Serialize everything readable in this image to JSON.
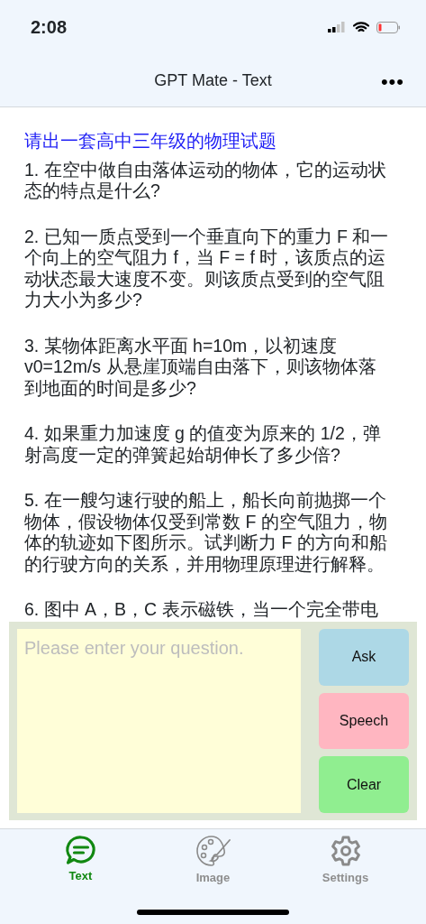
{
  "status_bar": {
    "time": "2:08"
  },
  "nav_bar": {
    "title": "GPT Mate - Text",
    "more": "•••"
  },
  "conversation": {
    "question": "请出一套高中三年级的物理试题",
    "answer": [
      [
        "1. 在空中做自由落体运动的物体，它的运动状",
        "态的特点是什么?"
      ],
      [
        "2. 已知一质点受到一个垂直向下的重力 F 和一",
        "个向上的空气阻力 f，当 F = f 时，该质点的运",
        "动状态最大速度不变。则该质点受到的空气阻",
        "力大小为多少?"
      ],
      [
        "3. 某物体距离水平面 h=10m，以初速度",
        "v0=12m/s 从悬崖顶端自由落下，则该物体落",
        "到地面的时间是多少?"
      ],
      [
        "4. 如果重力加速度 g 的值变为原来的 1/2，弹",
        "射高度一定的弹簧起始胡伸长了多少倍?"
      ],
      [
        "5. 在一艘匀速行驶的船上，船长向前抛掷一个",
        "物体，假设物体仅受到常数 F 的空气阻力，物",
        "体的轨迹如下图所示。试判断力 F 的方向和船",
        "的行驶方向的关系，并用物理原理进行解释。"
      ],
      [
        "6. 图中 A，B，C 表示磁铁，当一个完全带电"
      ]
    ]
  },
  "input": {
    "placeholder": "Please enter your question."
  },
  "buttons": [
    {
      "label": "Ask",
      "kind": "ask"
    },
    {
      "label": "Speech",
      "kind": "speech"
    },
    {
      "label": "Clear",
      "kind": "clear"
    }
  ],
  "tabs": [
    {
      "label": "Text",
      "kind": "text",
      "selected": true
    },
    {
      "label": "Image",
      "kind": "image",
      "selected": false
    },
    {
      "label": "Settings",
      "kind": "settings",
      "selected": false
    }
  ]
}
